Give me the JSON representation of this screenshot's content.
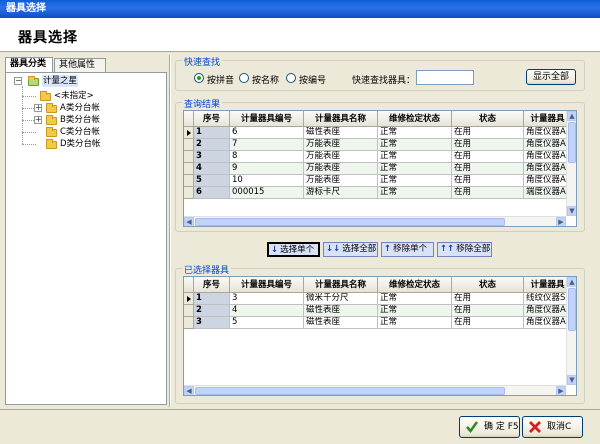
{
  "window": {
    "title": "器具选择"
  },
  "header": {
    "title": "器具选择"
  },
  "left_tabs": [
    {
      "label": "器具分类",
      "active": true
    },
    {
      "label": "其他属性",
      "active": false
    }
  ],
  "tree": {
    "root": "计量之星",
    "children": [
      "<未指定>",
      "A类分台帐",
      "B类分台帐",
      "C类分台帐",
      "D类分台帐"
    ]
  },
  "quick_search": {
    "group_title": "快速查找",
    "options": [
      {
        "label": "按拼音",
        "checked": true
      },
      {
        "label": "按名称",
        "checked": false
      },
      {
        "label": "按编号",
        "checked": false
      }
    ],
    "field_label": "快速查找器具：",
    "field_value": "",
    "show_all_button": "显示全部"
  },
  "results": {
    "group_title": "查询结果",
    "columns": [
      "序号",
      "计量器具编号",
      "计量器具名称",
      "维修检定状态",
      "状态",
      "计量器具"
    ],
    "rows": [
      [
        "1",
        "6",
        "磁性表座",
        "正常",
        "在用",
        "角度仪器A"
      ],
      [
        "2",
        "7",
        "万能表座",
        "正常",
        "在用",
        "角度仪器A"
      ],
      [
        "3",
        "8",
        "万能表座",
        "正常",
        "在用",
        "角度仪器A"
      ],
      [
        "4",
        "9",
        "万能表座",
        "正常",
        "在用",
        "角度仪器A"
      ],
      [
        "5",
        "10",
        "万能表座",
        "正常",
        "在用",
        "角度仪器A"
      ],
      [
        "6",
        "000015",
        "游标卡尺",
        "正常",
        "在用",
        "端度仪器A"
      ]
    ]
  },
  "move_buttons": [
    {
      "arrow": "↓",
      "label": "选择单个"
    },
    {
      "arrow": "↓↓",
      "label": "选择全部"
    },
    {
      "arrow": "↑",
      "label": "移除单个"
    },
    {
      "arrow": "↑↑",
      "label": "移除全部"
    }
  ],
  "selected": {
    "group_title": "已选择器具",
    "columns": [
      "序号",
      "计量器具编号",
      "计量器具名称",
      "维修检定状态",
      "状态",
      "计量器具"
    ],
    "rows": [
      [
        "1",
        "3",
        "微米千分尺",
        "正常",
        "在用",
        "线纹仪器S"
      ],
      [
        "2",
        "4",
        "磁性表座",
        "正常",
        "在用",
        "角度仪器A"
      ],
      [
        "3",
        "5",
        "磁性表座",
        "正常",
        "在用",
        "角度仪器A"
      ]
    ]
  },
  "footer": {
    "ok_label": "确 定 F5",
    "cancel_label": "取消C"
  },
  "colors": {
    "title_bar": "#0a5fd8",
    "group_title": "#0046d5",
    "row_odd": "#ffffff",
    "row_even": "#eef6ee",
    "row_header": "#ece9d8"
  }
}
